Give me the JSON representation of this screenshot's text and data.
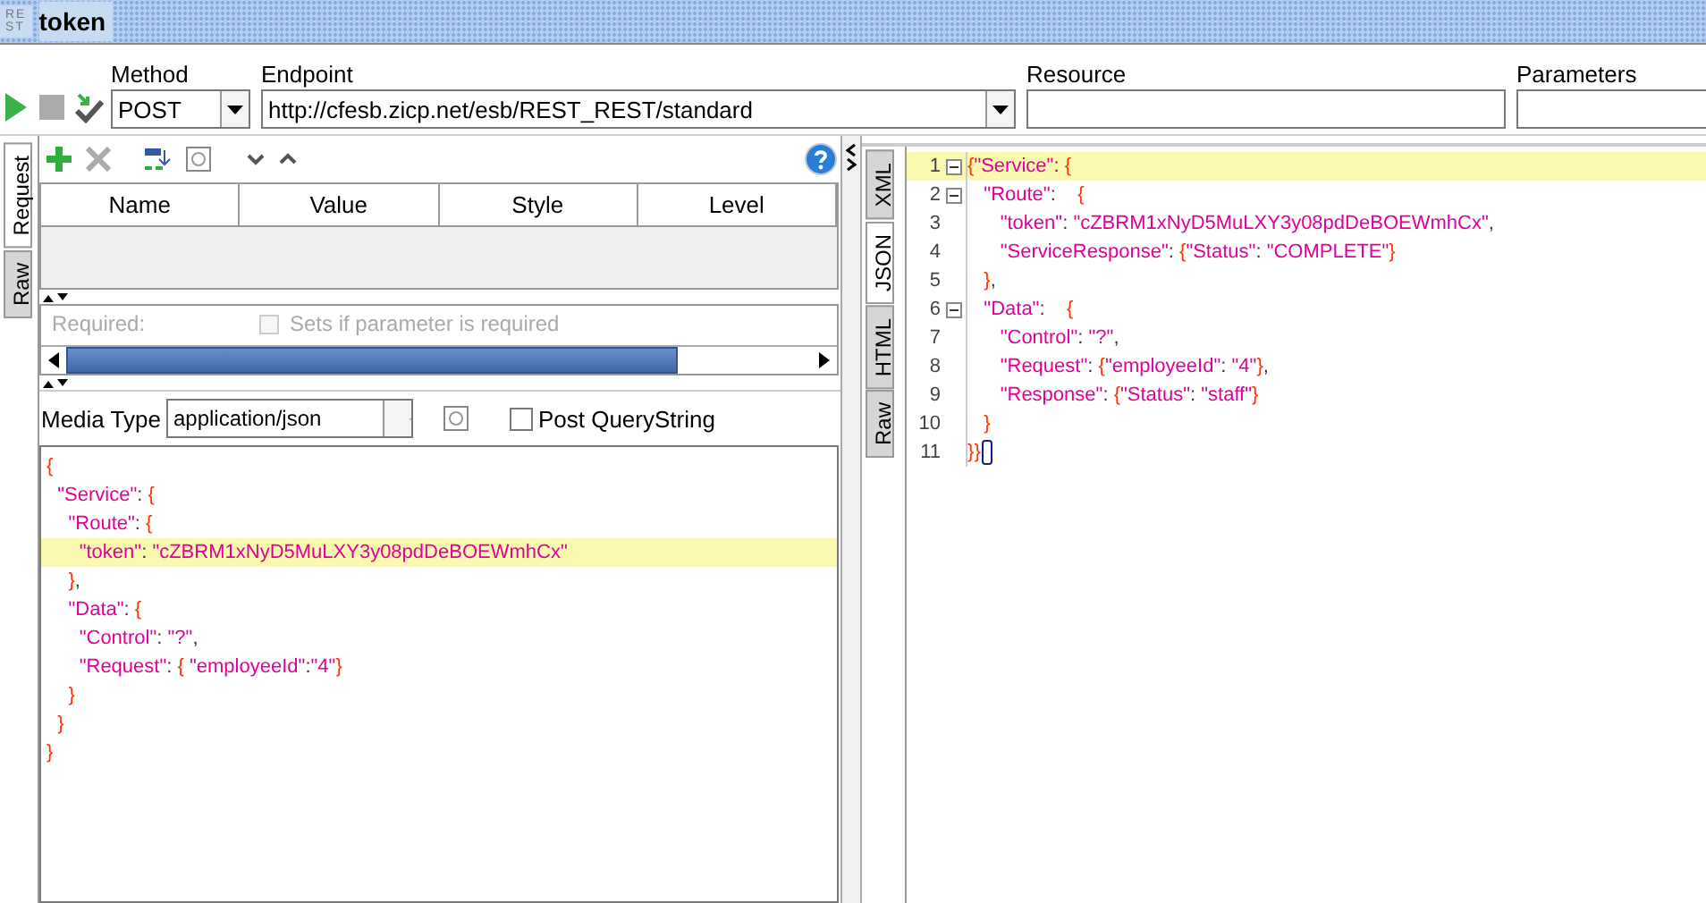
{
  "window": {
    "logo": [
      "RE",
      "ST"
    ],
    "title": "token"
  },
  "toolbar": {
    "method_label": "Method",
    "method": "POST",
    "endpoint_label": "Endpoint",
    "endpoint": "http://cfesb.zicp.net/esb/REST_REST/standard",
    "resource_label": "Resource",
    "parameters_label": "Parameters"
  },
  "request": {
    "tabs": [
      {
        "label": "Request",
        "selected": true
      },
      {
        "label": "Raw",
        "selected": false
      }
    ],
    "params_table": {
      "columns": [
        "Name",
        "Value",
        "Style",
        "Level"
      ]
    },
    "details": {
      "label": "Required:",
      "checkbox_label": "Sets if parameter is required",
      "checked": false,
      "disabled": true
    },
    "media_type_label": "Media Type",
    "media_type": "application/json",
    "post_querystring": {
      "label": "Post QueryString",
      "checked": false
    },
    "body": [
      {
        "text": "{",
        "highlighted": false
      },
      {
        "text": "  \"Service\": {",
        "highlighted": false
      },
      {
        "text": "    \"Route\": {",
        "highlighted": false
      },
      {
        "text": "      \"token\": \"cZBRM1xNyD5MuLXY3y08pdDeBOEWmhCx\"",
        "highlighted": true
      },
      {
        "text": "    },",
        "highlighted": false
      },
      {
        "text": "    \"Data\": {",
        "highlighted": false
      },
      {
        "text": "      \"Control\": \"?\",",
        "highlighted": false
      },
      {
        "text": "      \"Request\": { \"employeeId\":\"4\"}",
        "highlighted": false
      },
      {
        "text": "    }",
        "highlighted": false
      },
      {
        "text": "  }",
        "highlighted": false
      },
      {
        "text": "}",
        "highlighted": false
      }
    ]
  },
  "response": {
    "tabs": [
      {
        "label": "XML",
        "selected": false
      },
      {
        "label": "JSON",
        "selected": true
      },
      {
        "label": "HTML",
        "selected": false
      },
      {
        "label": "Raw",
        "selected": false
      }
    ],
    "lines": [
      {
        "number": "1",
        "fold": true,
        "highlighted": true,
        "text": "{\"Service\": {"
      },
      {
        "number": "2",
        "fold": true,
        "highlighted": false,
        "text": "   \"Route\":    {"
      },
      {
        "number": "3",
        "fold": false,
        "highlighted": false,
        "text": "      \"token\": \"cZBRM1xNyD5MuLXY3y08pdDeBOEWmhCx\","
      },
      {
        "number": "4",
        "fold": false,
        "highlighted": false,
        "text": "      \"ServiceResponse\": {\"Status\": \"COMPLETE\"}"
      },
      {
        "number": "5",
        "fold": false,
        "highlighted": false,
        "text": "   },"
      },
      {
        "number": "6",
        "fold": true,
        "highlighted": false,
        "text": "   \"Data\":    {"
      },
      {
        "number": "7",
        "fold": false,
        "highlighted": false,
        "text": "      \"Control\": \"?\","
      },
      {
        "number": "8",
        "fold": false,
        "highlighted": false,
        "text": "      \"Request\": {\"employeeId\": \"4\"},"
      },
      {
        "number": "9",
        "fold": false,
        "highlighted": false,
        "text": "      \"Response\": {\"Status\": \"staff\"}"
      },
      {
        "number": "10",
        "fold": false,
        "highlighted": false,
        "text": "   }"
      },
      {
        "number": "11",
        "fold": false,
        "highlighted": false,
        "text": "}}",
        "cursor": true
      }
    ]
  }
}
